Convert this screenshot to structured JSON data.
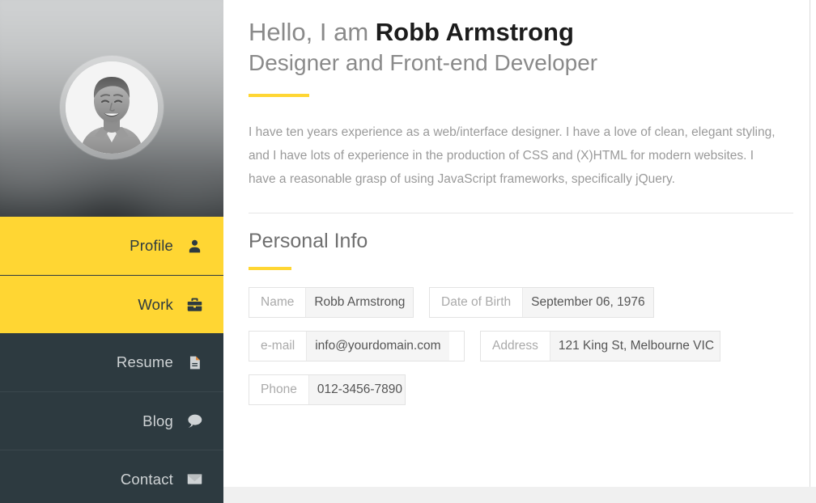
{
  "sidebar": {
    "avatar": {
      "alt": "portrait-photo",
      "icon": "user-portrait"
    },
    "nav": [
      {
        "label": "Profile",
        "icon": "person-icon",
        "state": "active"
      },
      {
        "label": "Work",
        "icon": "briefcase-icon",
        "state": "active"
      },
      {
        "label": "Resume",
        "icon": "document-icon",
        "state": "dark"
      },
      {
        "label": "Blog",
        "icon": "speech-bubble-icon",
        "state": "dark"
      },
      {
        "label": "Contact",
        "icon": "envelope-icon",
        "state": "dark"
      }
    ]
  },
  "header": {
    "greeting_prefix": "Hello, I am ",
    "name": "Robb Armstrong",
    "subtitle": "Designer and Front-end Developer"
  },
  "intro": {
    "text": "I have ten years experience as a web/interface designer. I have a love of clean, elegant styling, and I have lots of experience in the production of CSS and (X)HTML for modern websites. I have a reasonable grasp of using JavaScript frameworks, specifically jQuery."
  },
  "personal_info": {
    "title": "Personal Info",
    "fields": [
      {
        "label": "Name",
        "value": "Robb Armstrong"
      },
      {
        "label": "Date of Birth",
        "value": "September 06, 1976"
      },
      {
        "label": "e-mail",
        "value": "info@yourdomain.com"
      },
      {
        "label": "Address",
        "value": "121 King St, Melbourne VIC"
      },
      {
        "label": "Phone",
        "value": "012-3456-7890"
      }
    ]
  },
  "colors": {
    "accent_yellow": "#ffd633",
    "dark_slate": "#2d3a40",
    "body_text": "#9a9a9a",
    "heading_dark": "#1c1c1c",
    "field_value_bg": "#f5f5f5",
    "page_band": "#f0f0f0"
  }
}
